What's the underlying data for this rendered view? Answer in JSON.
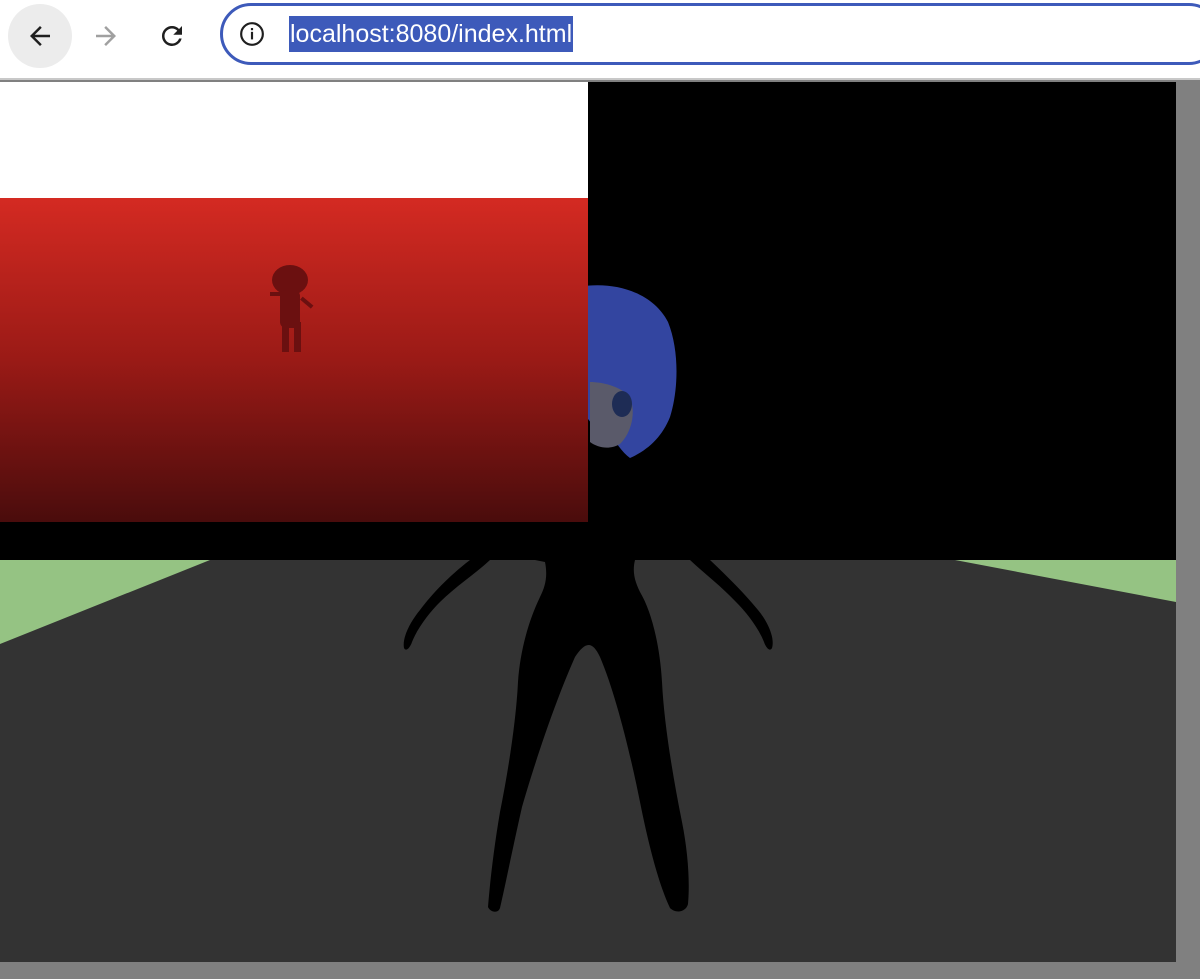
{
  "browser": {
    "url": "localhost:8080/index.html",
    "icons": {
      "back": "arrow-left-icon",
      "forward": "arrow-right-icon",
      "reload": "reload-icon",
      "site_info": "info-icon"
    },
    "colors": {
      "url_highlight": "#3d5aba",
      "omnibox_border": "#3d5aba"
    }
  },
  "scene": {
    "colors": {
      "background": "#000000",
      "ground": "#333333",
      "grass": "#95c383",
      "overlay_top": "#ffffff",
      "overlay_gradient_top": "#d42a22",
      "overlay_gradient_bottom": "#4a0c0c",
      "character_body": "#000000",
      "character_hair": "#3345a0"
    }
  }
}
